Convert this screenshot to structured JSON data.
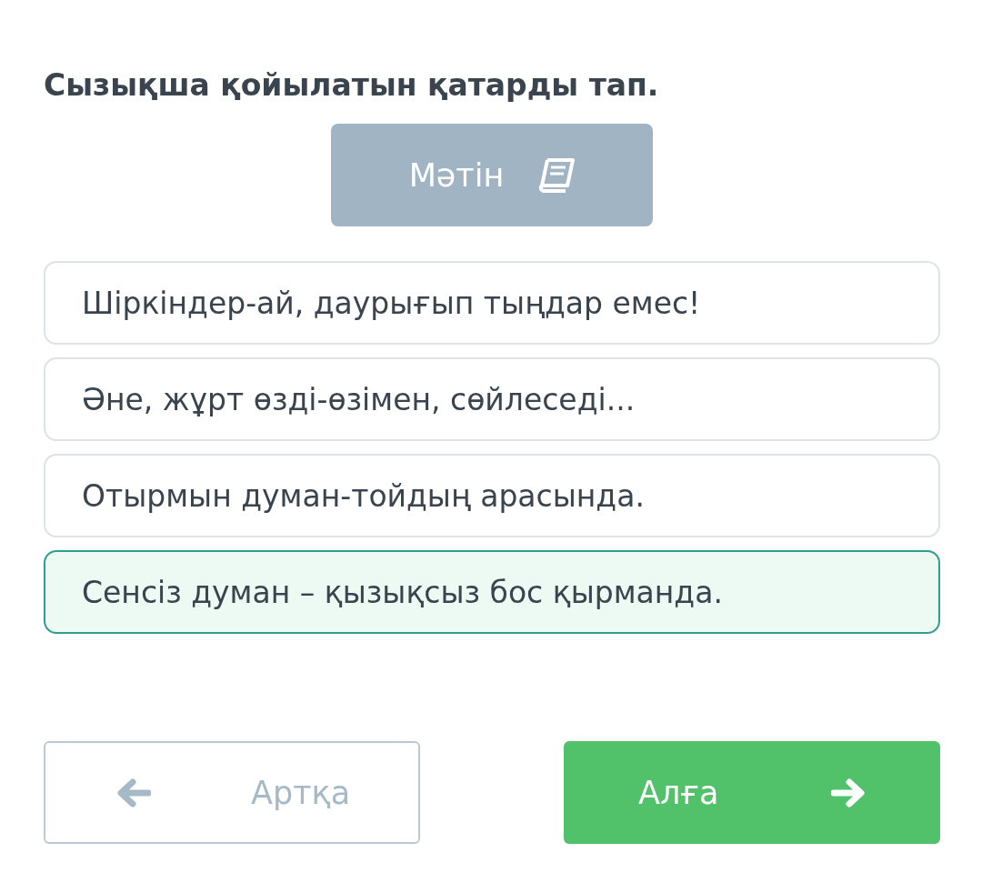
{
  "question": "Сызықша қойылатын қатарды тап.",
  "text_button": {
    "label": "Мәтін"
  },
  "options": [
    {
      "label": "Шіркіндер-ай, даурығып тыңдар емес!",
      "selected": false
    },
    {
      "label": "Әне, жұрт өзді-өзімен, сөйлеседі...",
      "selected": false
    },
    {
      "label": "Отырмын думан-тойдың арасында.",
      "selected": false
    },
    {
      "label": "Сенсіз думан – қызықсыз бос қырманда.",
      "selected": true
    }
  ],
  "back_button": {
    "label": "Артқа",
    "disabled": true
  },
  "next_button": {
    "label": "Алға"
  }
}
